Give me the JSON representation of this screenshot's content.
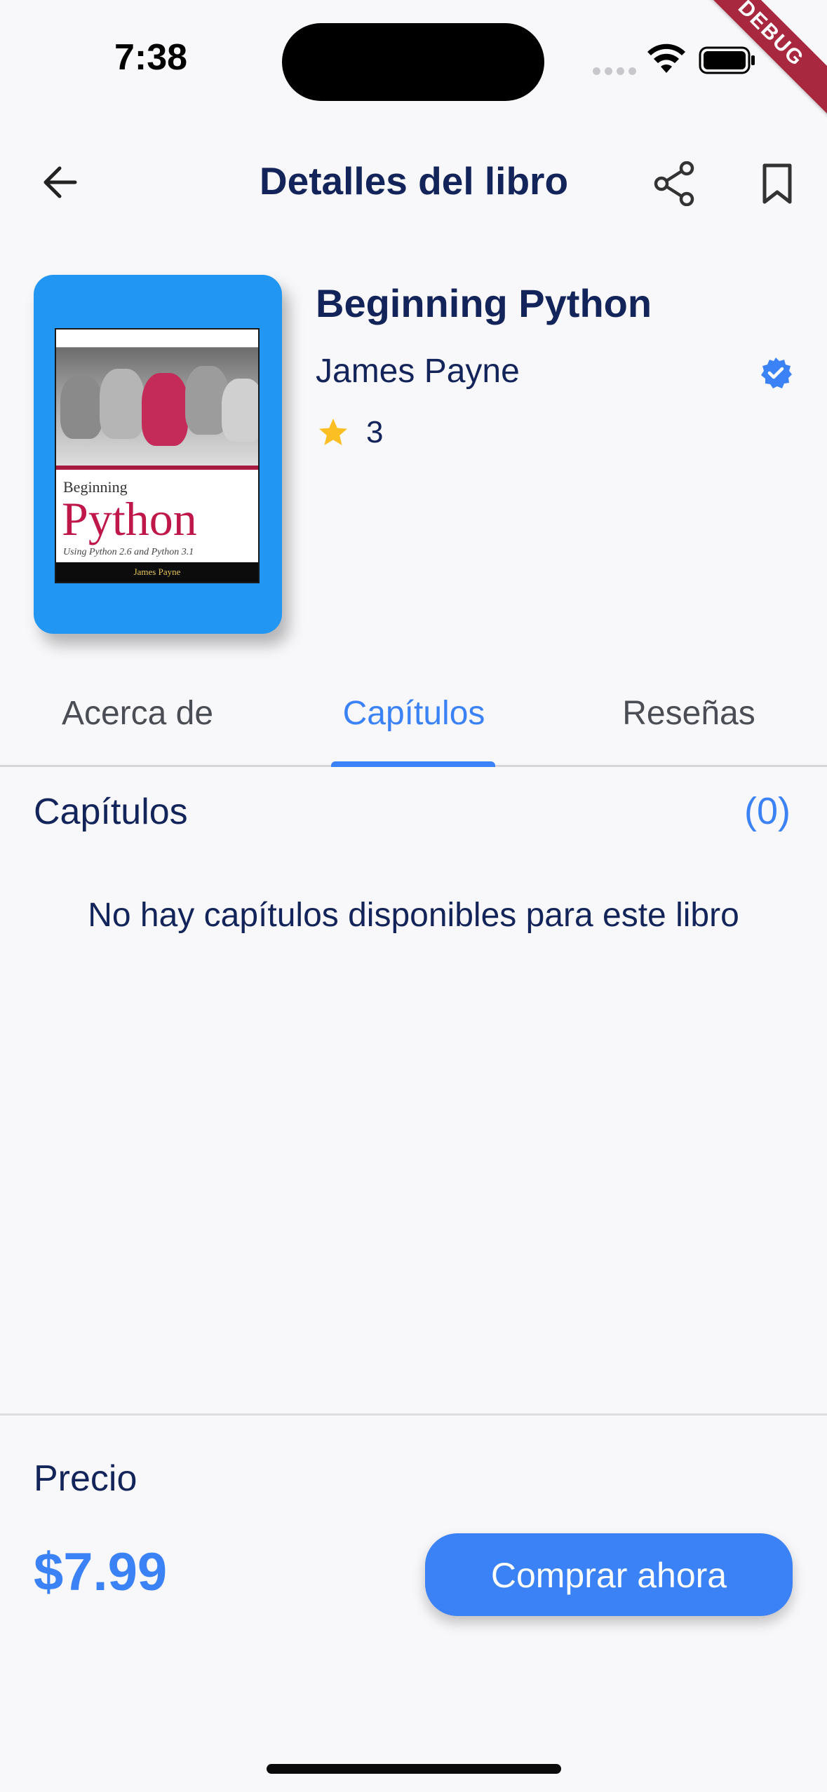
{
  "status_bar": {
    "time": "7:38",
    "debug_label": "DEBUG"
  },
  "app_bar": {
    "title": "Detalles del libro",
    "back_icon": "arrow-left-icon",
    "share_icon": "share-icon",
    "bookmark_icon": "bookmark-icon"
  },
  "book": {
    "title": "Beginning Python",
    "author": "James Payne",
    "rating": "3",
    "verified_icon": "verified-badge-icon",
    "cover": {
      "beginning": "Beginning",
      "python": "Python",
      "subtitle": "Using Python 2.6 and Python 3.1",
      "author": "James Payne",
      "background_color": "#2196f3"
    }
  },
  "tabs": [
    {
      "label": "Acerca de",
      "active": false
    },
    {
      "label": "Capítulos",
      "active": true
    },
    {
      "label": "Reseñas",
      "active": false
    }
  ],
  "chapters": {
    "title": "Capítulos",
    "count": "(0)",
    "empty_message": "No hay capítulos disponibles para este libro"
  },
  "purchase": {
    "price_label": "Precio",
    "price": "$7.99",
    "buy_label": "Comprar ahora"
  },
  "colors": {
    "accent": "#3b82f6",
    "text_primary": "#13245a",
    "star": "#fbbf24",
    "debug_ribbon": "#a8283f"
  }
}
